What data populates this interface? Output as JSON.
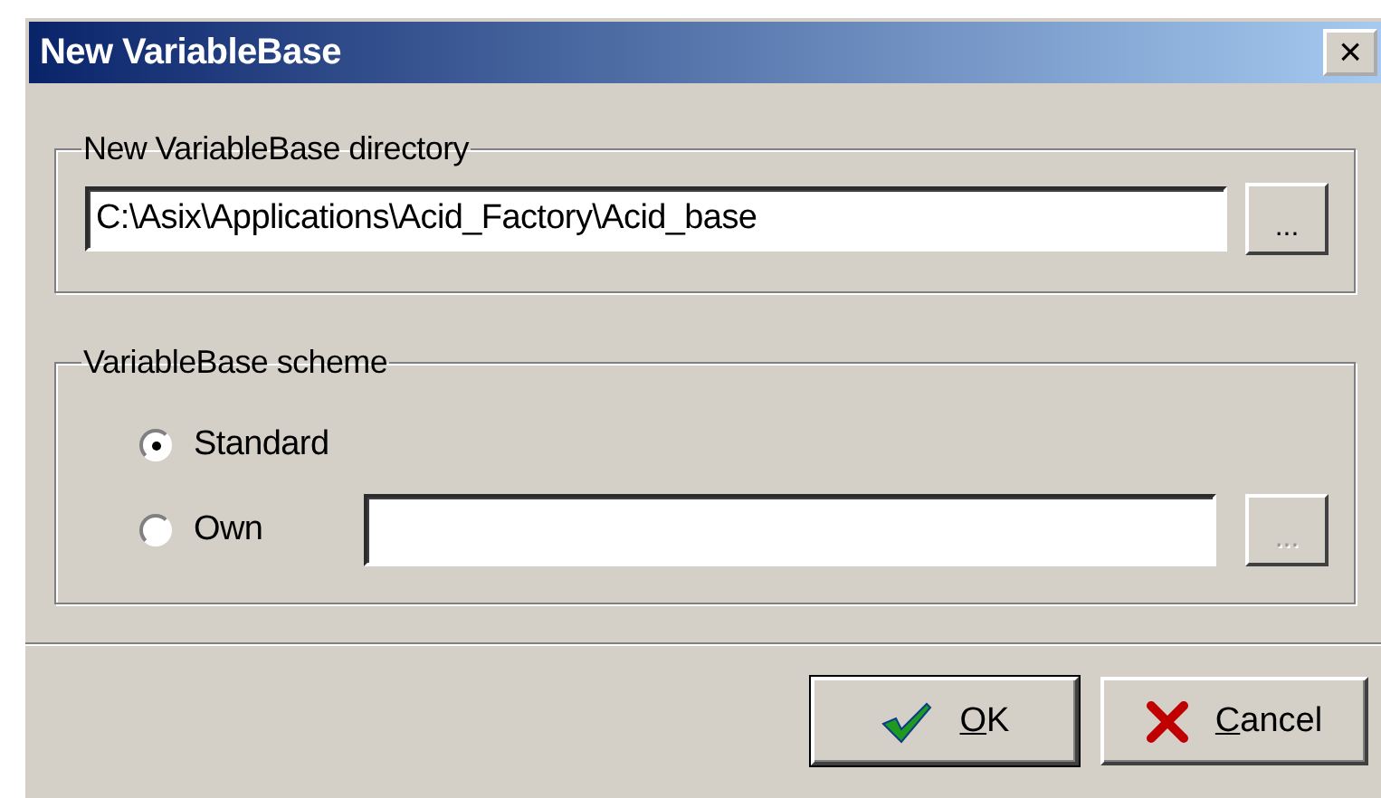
{
  "window": {
    "title": "New VariableBase",
    "close": "×"
  },
  "directory_group": {
    "title": "New VariableBase directory",
    "path": "C:\\Asix\\Applications\\Acid_Factory\\Acid_base",
    "browse": {
      "label": "...",
      "disabled": false
    }
  },
  "scheme_group": {
    "title": "VariableBase scheme",
    "options": [
      {
        "label": "Standard",
        "selected": true,
        "kind": "plain"
      },
      {
        "label": "Own",
        "selected": false,
        "kind": "field",
        "browse": {
          "label": "...",
          "disabled": true
        }
      }
    ]
  },
  "buttons": [
    {
      "label": "OK",
      "kind": "ok"
    },
    {
      "label": "Cancel",
      "kind": "cancel"
    }
  ]
}
